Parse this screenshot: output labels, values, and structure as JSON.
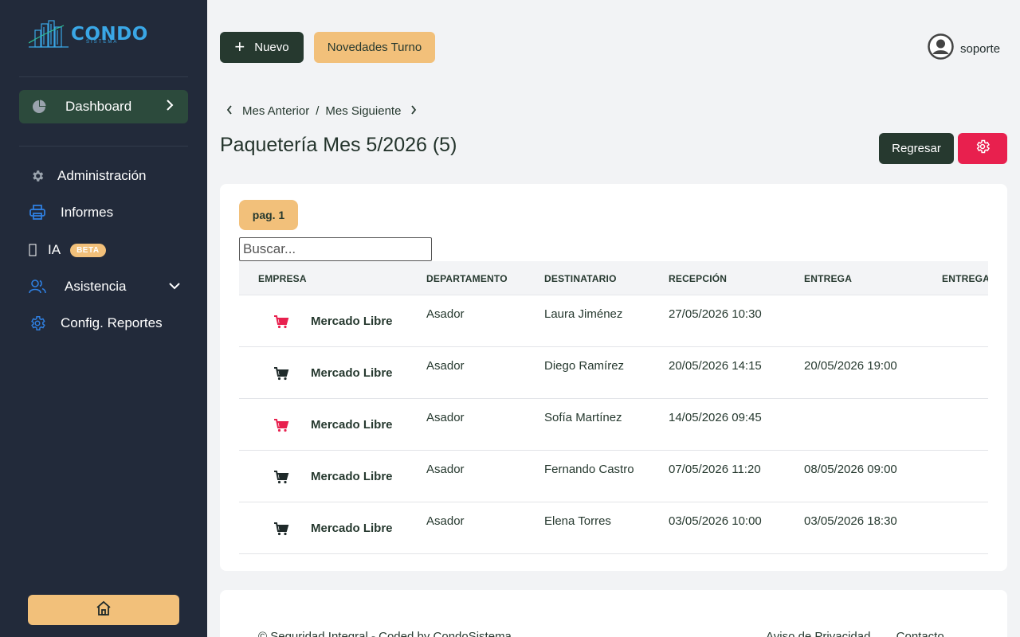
{
  "brand": {
    "name": "CONDO",
    "sub": "SISTEMA"
  },
  "sidebar": {
    "dashboard": "Dashboard",
    "items": [
      {
        "label": "Administración",
        "icon": "gear-icon"
      },
      {
        "label": "Informes",
        "icon": "printer-icon"
      },
      {
        "label": "IA",
        "icon": "ai-icon",
        "badge": "BETA"
      },
      {
        "label": "Asistencia",
        "icon": "users-icon"
      },
      {
        "label": "Config. Reportes",
        "icon": "settings-icon"
      }
    ]
  },
  "topbar": {
    "new_label": "Nuevo",
    "novedades_label": "Novedades Turno",
    "user": "soporte"
  },
  "breadcrumb": {
    "prev": "Mes Anterior",
    "sep": "/",
    "next": "Mes Siguiente"
  },
  "page": {
    "title": "Paquetería Mes 5/2026 (5)",
    "back_label": "Regresar"
  },
  "table": {
    "page_label": "pag. 1",
    "search_placeholder": "Buscar...",
    "columns": [
      "EMPRESA",
      "DEPARTAMENTO",
      "DESTINATARIO",
      "RECEPCIÓN",
      "ENTREGA",
      "ENTREGADO"
    ],
    "rows": [
      {
        "company": "Mercado Libre",
        "department": "Asador",
        "recipient": "Laura Jiménez",
        "received": "27/05/2026 10:30",
        "delivered": "",
        "cart_color": "#e8204e"
      },
      {
        "company": "Mercado Libre",
        "department": "Asador",
        "recipient": "Diego Ramírez",
        "received": "20/05/2026 14:15",
        "delivered": "20/05/2026 19:00",
        "cart_color": "#1f2a2a"
      },
      {
        "company": "Mercado Libre",
        "department": "Asador",
        "recipient": "Sofía Martínez",
        "received": "14/05/2026 09:45",
        "delivered": "",
        "cart_color": "#e8204e"
      },
      {
        "company": "Mercado Libre",
        "department": "Asador",
        "recipient": "Fernando Castro",
        "received": "07/05/2026 11:20",
        "delivered": "08/05/2026 09:00",
        "cart_color": "#1f2a2a"
      },
      {
        "company": "Mercado Libre",
        "department": "Asador",
        "recipient": "Elena Torres",
        "received": "03/05/2026 10:00",
        "delivered": "03/05/2026 18:30",
        "cart_color": "#1f2a2a"
      }
    ]
  },
  "footer": {
    "copyright": "© Seguridad Integral - Coded by CondoSistema",
    "privacy": "Aviso de Privacidad",
    "contact": "Contacto"
  },
  "colors": {
    "sidebar_bg": "#222a3a",
    "primary_dark": "#26392f",
    "accent_yellow": "#f2c07a",
    "danger": "#e8204e",
    "brand_blue": "#3aa7e6"
  }
}
